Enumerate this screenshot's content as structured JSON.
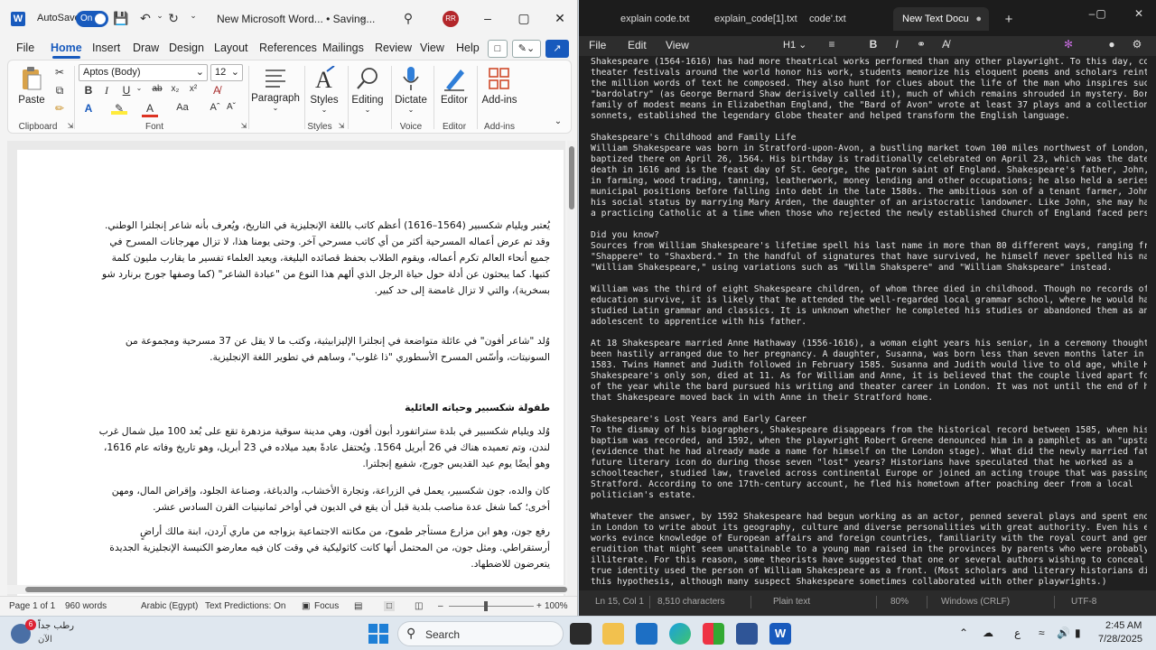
{
  "word": {
    "autosave_label": "AutoSave",
    "autosave_state": "On",
    "title": "New Microsoft Word... • Saving...",
    "user_initials": "RR",
    "menu": [
      "File",
      "Home",
      "Insert",
      "Draw",
      "Design",
      "Layout",
      "References",
      "Mailings",
      "Review",
      "View",
      "Help"
    ],
    "active_menu": "Home",
    "ribbon": {
      "paste": "Paste",
      "font_name": "Aptos (Body)",
      "font_size": "12",
      "paragraph": "Paragraph",
      "styles": "Styles",
      "editing": "Editing",
      "dictate": "Dictate",
      "editor": "Editor",
      "addins": "Add-ins",
      "groups": {
        "clipboard": "Clipboard",
        "font": "Font",
        "styles": "Styles",
        "voice": "Voice",
        "editor": "Editor",
        "addins": "Add-ins"
      }
    },
    "document": {
      "p1": "يُعتبر ويليام شكسبير (1564–1616) أعظم كاتب باللغة الإنجليزية في التاريخ، ويُعرف بأنه شاعر إنجلترا الوطني. وقد تم عرض أعماله المسرحية أكثر من أي كاتب مسرحي آخر. وحتى يومنا هذا، لا تزال مهرجانات المسرح في جميع أنحاء العالم تكرم أعماله، ويقوم الطلاب بحفظ قصائده البليغة، ويعيد العلماء تفسير ما يقارب مليون كلمة كتبها. كما يبحثون عن أدلة حول حياة الرجل الذي ألهم هذا النوع من \"عبادة الشاعر\" (كما وصفها جورج برنارد شو بسخرية)، والتي لا تزال غامضة إلى حد كبير.",
      "p2": "وُلد \"شاعر أفون\" في عائلة متواضعة في إنجلترا الإليزابيثية، وكتب ما لا يقل عن 37 مسرحية ومجموعة من السونيتات، وأسّس المسرح الأسطوري \"ذا غلوب\"، وساهم في تطوير اللغة الإنجليزية.",
      "h1": "طفولة شكسبير وحياته العائلية",
      "p3": "وُلد ويليام شكسبير في بلدة ستراتفورد أبون أفون، وهي مدينة سوقية مزدهرة تقع على بُعد 100 ميل شمال غرب لندن، وتم تعميده هناك في 26 أبريل 1564. ويُحتفل عادةً بعيد ميلاده في 23 أبريل، وهو تاريخ وفاته عام 1616، وهو أيضًا يوم عيد القديس جورج، شفيع إنجلترا.",
      "p4": "كان والده، جون شكسبير، يعمل في الزراعة، وتجارة الأخشاب، والدباغة، وصناعة الجلود، وإقراض المال، ومهن أخرى؛ كما شغل عدة مناصب بلدية قبل أن يقع في الديون في أواخر ثمانينيات القرن السادس عشر.",
      "p5": "رفع جون، وهو ابن مزارع مستأجر طموح، من مكانته الاجتماعية بزواجه من ماري آردن، ابنة مالك أراضٍ أرستقراطي. ومثل جون، من المحتمل أنها كانت كاثوليكية في وقت كان فيه معارضو الكنيسة الإنجليزية الجديدة يتعرضون للاضطهاد."
    },
    "status": {
      "page": "Page 1 of 1",
      "words": "960 words",
      "language": "Arabic (Egypt)",
      "predictions": "Text Predictions: On",
      "focus": "Focus",
      "zoom": "100%"
    }
  },
  "notepad": {
    "tabs": [
      "explain code.txt",
      "explain_code[1].txt",
      "code'.txt",
      "New Text Docu"
    ],
    "active_tab": "New Text Docu",
    "menu": [
      "File",
      "Edit",
      "View"
    ],
    "heading_btn": "H1",
    "text": "Shakespeare (1564-1616) has had more theatrical works performed than any other playwright. To this day, countless\ntheater festivals around the world honor his work, students memorize his eloquent poems and scholars reinterpret\nthe million words of text he composed. They also hunt for clues about the life of the man who inspires such\n\"bardolatry\" (as George Bernard Shaw derisively called it), much of which remains shrouded in mystery. Born into a\nfamily of modest means in Elizabethan England, the \"Bard of Avon\" wrote at least 37 plays and a collection of\nsonnets, established the legendary Globe theater and helped transform the English language.\n\nShakespeare's Childhood and Family Life\nWilliam Shakespeare was born in Stratford-upon-Avon, a bustling market town 100 miles northwest of London, and\nbaptized there on April 26, 1564. His birthday is traditionally celebrated on April 23, which was the date of his\ndeath in 1616 and is the feast day of St. George, the patron saint of England. Shakespeare's father, John, dabbled\nin farming, wood trading, tanning, leatherwork, money lending and other occupations; he also held a series of\nmunicipal positions before falling into debt in the late 1580s. The ambitious son of a tenant farmer, John boosted\nhis social status by marrying Mary Arden, the daughter of an aristocratic landowner. Like John, she may have been\na practicing Catholic at a time when those who rejected the newly established Church of England faced persecution.\n\nDid you know?\nSources from William Shakespeare's lifetime spell his last name in more than 80 different ways, ranging from\n\"Shappere\" to \"Shaxberd.\" In the handful of signatures that have survived, he himself never spelled his name\n\"William Shakespeare,\" using variations such as \"Willm Shakspere\" and \"William Shakspeare\" instead.\n\nWilliam was the third of eight Shakespeare children, of whom three died in childhood. Though no records of his\neducation survive, it is likely that he attended the well-regarded local grammar school, where he would have\nstudied Latin grammar and classics. It is unknown whether he completed his studies or abandoned them as an\nadolescent to apprentice with his father.\n\nAt 18 Shakespeare married Anne Hathaway (1556-1616), a woman eight years his senior, in a ceremony thought to have\nbeen hastily arranged due to her pregnancy. A daughter, Susanna, was born less than seven months later in May\n1583. Twins Hamnet and Judith followed in February 1585. Susanna and Judith would live to old age, while Hamnet,\nShakespeare's only son, died at 11. As for William and Anne, it is believed that the couple lived apart for most\nof the year while the bard pursued his writing and theater career in London. It was not until the end of his life\nthat Shakespeare moved back in with Anne in their Stratford home.\n\nShakespeare's Lost Years and Early Career\nTo the dismay of his biographers, Shakespeare disappears from the historical record between 1585, when his twins'\nbaptism was recorded, and 1592, when the playwright Robert Greene denounced him in a pamphlet as an \"upstart crow\"\n(evidence that he had already made a name for himself on the London stage). What did the newly married father and\nfuture literary icon do during those seven \"lost\" years? Historians have speculated that he worked as a\nschoolteacher, studied law, traveled across continental Europe or joined an acting troupe that was passing through\nStratford. According to one 17th-century account, he fled his hometown after poaching deer from a local\npolitician's estate.\n\nWhatever the answer, by 1592 Shakespeare had begun working as an actor, penned several plays and spent enough time\nin London to write about its geography, culture and diverse personalities with great authority. Even his earliest\nworks evince knowledge of European affairs and foreign countries, familiarity with the royal court and general\nerudition that might seem unattainable to a young man raised in the provinces by parents who were probably\nilliterate. For this reason, some theorists have suggested that one or several authors wishing to conceal their\ntrue identity used the person of William Shakespeare as a front. (Most scholars and literary historians dismiss\nthis hypothesis, although many suspect Shakespeare sometimes collaborated with other playwrights.)",
    "status": {
      "position": "Ln 15, Col 1",
      "chars": "8,510 characters",
      "mode": "Plain text",
      "zoom": "80%",
      "eol": "Windows (CRLF)",
      "encoding": "UTF-8"
    }
  },
  "taskbar": {
    "weather_line1": "رطب جداً",
    "weather_line2": "الآن",
    "weather_badge": "6",
    "search": "Search",
    "lang": "ع",
    "time": "2:45 AM",
    "date": "7/28/2025"
  }
}
